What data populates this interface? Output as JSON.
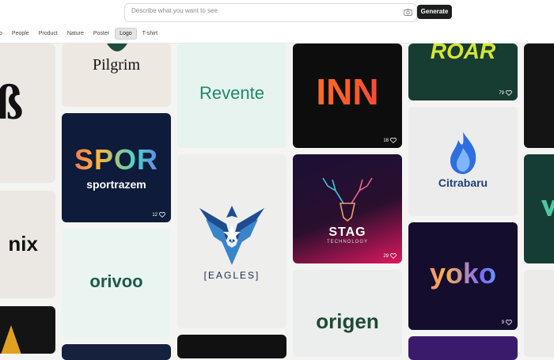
{
  "search": {
    "placeholder": "Describe what you want to see",
    "button_label": "Generate"
  },
  "categories": {
    "c0": "p",
    "c1": "People",
    "c2": "Product",
    "c3": "Nature",
    "c4": "Poster",
    "c5": "Logo",
    "c6": "T-shirt",
    "active": "Logo"
  },
  "cards": {
    "pilgrim": {
      "text": "Pilgrim"
    },
    "sportrazem": {
      "big": "SPOR",
      "small": "sportrazem",
      "likes": "12"
    },
    "orivoo": {
      "text": "orivoo"
    },
    "revente": {
      "text": "Revente"
    },
    "eagles": {
      "text": "[EAGLES]"
    },
    "inn": {
      "text": "INN",
      "likes": "16"
    },
    "stag": {
      "title": "STAG",
      "sub": "TECHNOLOGY",
      "likes": "29"
    },
    "origen": {
      "text": "origen"
    },
    "roar": {
      "text": "ROAR",
      "likes": "79"
    },
    "citrabaru": {
      "text": "Citrabaru"
    },
    "yoko": {
      "text": "yoko",
      "likes": "9"
    },
    "nix": {
      "text": "nix"
    }
  },
  "colors": {
    "accent_dark": "#1d1f1e",
    "revente_green": "#1f8a6a",
    "yoko_bg": "#140d2e"
  }
}
